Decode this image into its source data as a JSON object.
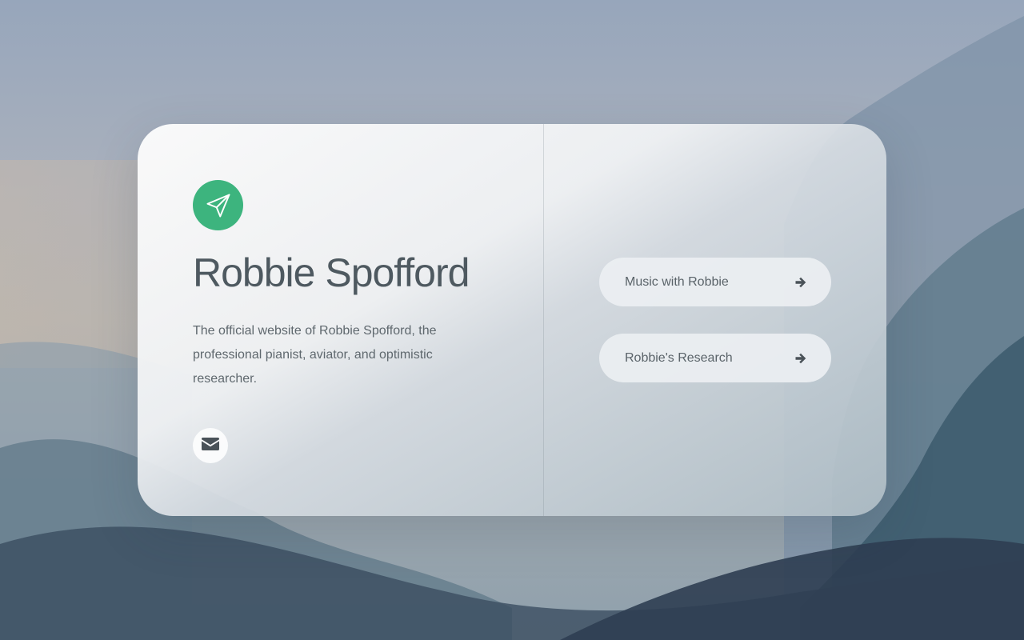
{
  "profile": {
    "name": "Robbie Spofford",
    "bio": "The official website of Robbie Spofford, the professional pianist, aviator, and optimistic researcher.",
    "logo_icon": "paper-plane-icon",
    "contact_icon": "envelope-icon"
  },
  "links": [
    {
      "label": "Music with Robbie",
      "icon": "arrow-right-icon"
    },
    {
      "label": "Robbie's Research",
      "icon": "arrow-right-icon"
    }
  ],
  "colors": {
    "accent": "#3db47e",
    "text": "#4e5960",
    "icon": "#4a5258"
  }
}
